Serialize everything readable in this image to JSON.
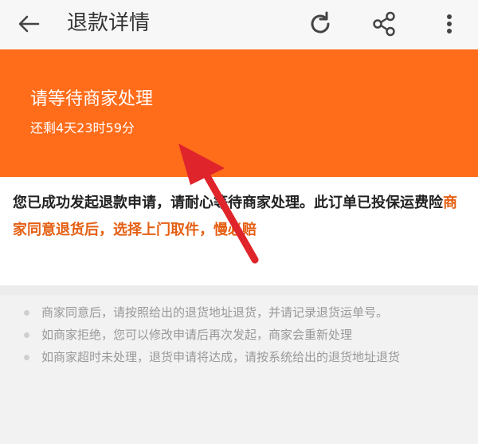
{
  "header": {
    "title": "退款详情",
    "icons": [
      "back-arrow-icon",
      "refresh-icon",
      "share-icon",
      "more-icon"
    ]
  },
  "status": {
    "title": "请等待商家处理",
    "countdown": "还剩4天23时59分",
    "background_color": "#ff6c1a"
  },
  "notice": {
    "text_1": "您已成功发起退款申请，请耐心等待商家处理。此订单已投保运费险",
    "text_2": "商家同意退货后，选择上门取件，慢必赔",
    "accent_color": "#e55f13"
  },
  "tips": [
    "商家同意后，请按照给出的退货地址退货，并请记录退货运单号。",
    "如商家拒绝，您可以修改申请后再次发起，商家会重新处理",
    "如商家超时未处理，退货申请将达成，请按系统给出的退货地址退货"
  ],
  "annotation": {
    "color": "#e0242b",
    "icon": "red-arrow-annotation"
  }
}
